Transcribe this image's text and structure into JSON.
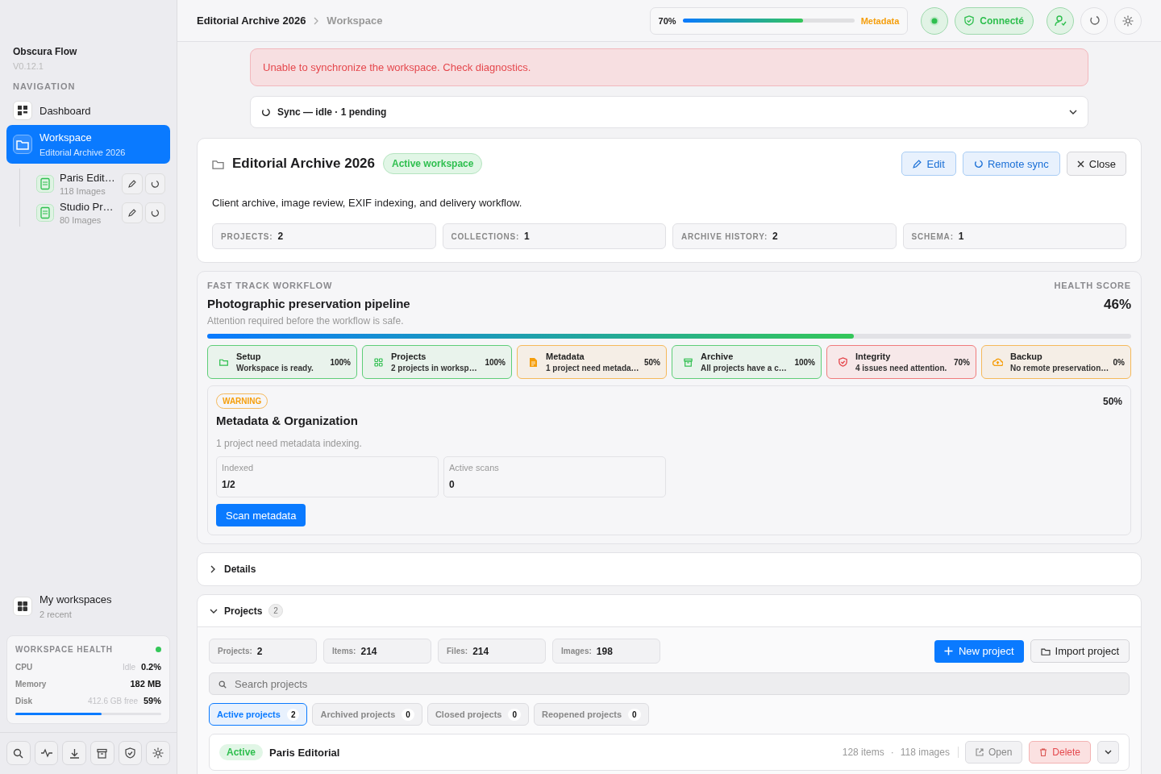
{
  "app": {
    "name": "Obscura Flow",
    "version": "V0.12.1"
  },
  "sidebar": {
    "section": "NAVIGATION",
    "items": [
      {
        "label": "Dashboard",
        "selected": false,
        "kind": "grid"
      },
      {
        "label": "Workspace",
        "sublabel": "Editorial Archive 2026",
        "selected": true,
        "kind": "folder"
      }
    ],
    "projects": [
      {
        "name": "Paris Edit…",
        "count": "118 Images"
      },
      {
        "name": "Studio Pr…",
        "count": "80 Images"
      }
    ],
    "workspaces": {
      "label": "My workspaces",
      "sublabel": "2 recent"
    },
    "health": {
      "title": "WORKSPACE HEALTH",
      "online": true,
      "rows": [
        {
          "label": "CPU",
          "note": "Idle",
          "value": "0.2%"
        },
        {
          "label": "Memory",
          "note": null,
          "value": "182 MB"
        },
        {
          "label": "Disk",
          "note": "412.6 GB free",
          "value": "59%"
        }
      ],
      "level": 0.59
    }
  },
  "header": {
    "breadcrumb": [
      "Editorial Archive 2026",
      "Workspace"
    ],
    "progress": {
      "reading": "70%",
      "level": 0.7,
      "label": "Metadata"
    },
    "connection": "Connecté"
  },
  "alert": "Unable to synchronize the workspace. Check diagnostics.",
  "sync": {
    "label": "Sync — idle · 1 pending",
    "expanded": false
  },
  "workspace": {
    "title": "Editorial Archive 2026",
    "badge": "Active workspace",
    "description": "Client archive, image review, EXIF indexing, and delivery workflow.",
    "actions": [
      "Edit",
      "Remote sync",
      "Close"
    ],
    "stats": [
      {
        "label": "PROJECTS:",
        "value": "2"
      },
      {
        "label": "COLLECTIONS:",
        "value": "1"
      },
      {
        "label": "ARCHIVE HISTORY:",
        "value": "2"
      },
      {
        "label": "SCHEMA:",
        "value": "1"
      }
    ]
  },
  "workflow": {
    "eyebrow": "FAST TRACK WORKFLOW",
    "title": "Photographic preservation pipeline",
    "subtitle": "Attention required before the workflow is safe.",
    "score_label": "HEALTH SCORE",
    "score": "46%",
    "level": 0.7,
    "steps": [
      {
        "title": "Setup",
        "text": "Workspace is ready.",
        "percent": "100%",
        "kind": "ok"
      },
      {
        "title": "Projects",
        "text": "2 projects in worksp…",
        "percent": "100%",
        "kind": "ok"
      },
      {
        "title": "Metadata",
        "text": "1 project need metada…",
        "percent": "50%",
        "kind": "warning"
      },
      {
        "title": "Archive",
        "text": "All projects have a c…",
        "percent": "100%",
        "kind": "ok"
      },
      {
        "title": "Integrity",
        "text": "4 issues need attention.",
        "percent": "70%",
        "kind": "danger"
      },
      {
        "title": "Backup",
        "text": "No remote preservation…",
        "percent": "0%",
        "kind": "warning"
      }
    ],
    "detail": {
      "badge": "WARNING",
      "percent": "50%",
      "title": "Metadata & Organization",
      "text": "1 project need metadata indexing.",
      "metrics": [
        {
          "label": "Indexed",
          "value": "1/2"
        },
        {
          "label": "Active scans",
          "value": "0"
        }
      ],
      "action": "Scan metadata"
    }
  },
  "details": {
    "label": "Details",
    "expanded": false
  },
  "projects": {
    "label": "Projects",
    "count": "2",
    "expanded": true,
    "stats": [
      {
        "label": "Projects:",
        "value": "2"
      },
      {
        "label": "Items:",
        "value": "214"
      },
      {
        "label": "Files:",
        "value": "214"
      },
      {
        "label": "Images:",
        "value": "198"
      }
    ],
    "actions": [
      "New project",
      "Import project"
    ],
    "search": {
      "placeholder": "Search projects"
    },
    "tabs": [
      {
        "label": "Active projects",
        "count": "2",
        "selected": true
      },
      {
        "label": "Archived projects",
        "count": "0",
        "selected": false
      },
      {
        "label": "Closed projects",
        "count": "0",
        "selected": false
      },
      {
        "label": "Reopened projects",
        "count": "0",
        "selected": false
      }
    ],
    "rows": [
      {
        "status": "Active",
        "name": "Paris Editorial",
        "items": "128 items",
        "separator": "·",
        "images": "118 images",
        "open": "Open",
        "delete": "Delete"
      }
    ]
  }
}
